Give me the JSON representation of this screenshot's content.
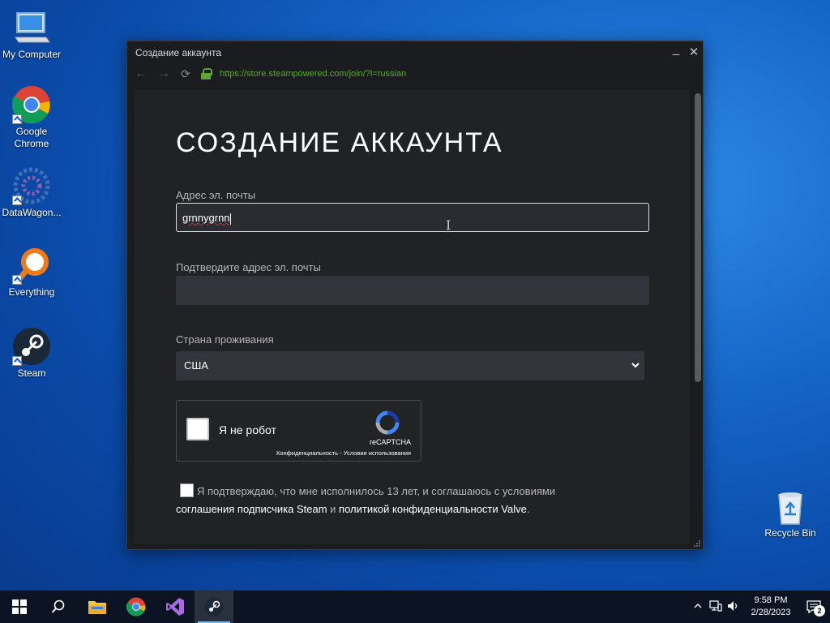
{
  "desktop": {
    "icons": [
      {
        "label": "My Computer"
      },
      {
        "label": "Google Chrome"
      },
      {
        "label": "DataWagon..."
      },
      {
        "label": "Everything"
      },
      {
        "label": "Steam"
      },
      {
        "label": "Recycle Bin"
      }
    ]
  },
  "window": {
    "title": "Создание аккаунта",
    "url": "https://store.steampowered.com/join/?l=russian",
    "minimize_glyph": "_",
    "close_glyph": "✕",
    "back_glyph": "←",
    "forward_glyph": "→",
    "reload_glyph": "⟳"
  },
  "form": {
    "heading": "СОЗДАНИЕ АККАУНТА",
    "email_label": "Адрес эл. почты",
    "email_value": "grnnygrnn",
    "confirm_label": "Подтвердите адрес эл. почты",
    "confirm_value": "",
    "country_label": "Страна проживания",
    "country_value": "США",
    "captcha_text": "Я не робот",
    "captcha_brand": "reCAPTCHA",
    "captcha_links": "Конфиденциальность - Условия использования",
    "agree_text": "Я подтверждаю, что мне исполнилось 13 лет, и соглашаюсь с условиями",
    "agree_link1": "соглашения подписчика Steam",
    "agree_and": " и ",
    "agree_link2": "политикой конфиденциальности Valve",
    "agree_end": "."
  },
  "taskbar": {
    "time": "9:58 PM",
    "date": "2/28/2023",
    "notification_count": "2"
  },
  "colors": {
    "url_green": "#5fa533",
    "page_bg": "#212226",
    "input_bg": "#32353c",
    "taskbar_bg": "#0c1424"
  }
}
